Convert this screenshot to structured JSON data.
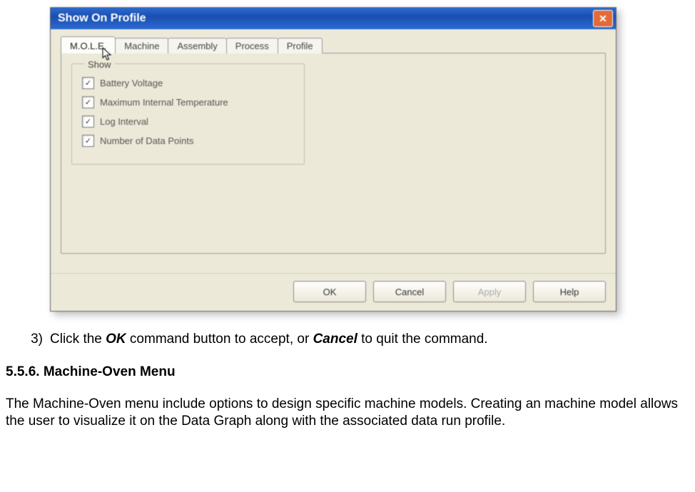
{
  "dialog": {
    "title": "Show On Profile",
    "tabs": {
      "mole": "M.O.L.E.",
      "machine": "Machine",
      "assembly": "Assembly",
      "process": "Process",
      "profile": "Profile"
    },
    "group_legend": "Show",
    "checks": {
      "battery": "Battery Voltage",
      "maxtemp": "Maximum Internal Temperature",
      "loginterval": "Log Interval",
      "numpoints": "Number of Data Points"
    },
    "buttons": {
      "ok": "OK",
      "cancel": "Cancel",
      "apply": "Apply",
      "help": "Help"
    }
  },
  "doc": {
    "step_number": "3)",
    "step_prefix": "Click the ",
    "step_ok": "OK",
    "step_mid": " command button to accept, or ",
    "step_cancel": "Cancel",
    "step_suffix": " to quit the command.",
    "section_heading": "5.5.6. Machine-Oven Menu",
    "paragraph": "The Machine-Oven menu include options to design specific machine models. Creating an machine model allows the user to visualize it on the Data Graph along with the associated data run profile."
  }
}
